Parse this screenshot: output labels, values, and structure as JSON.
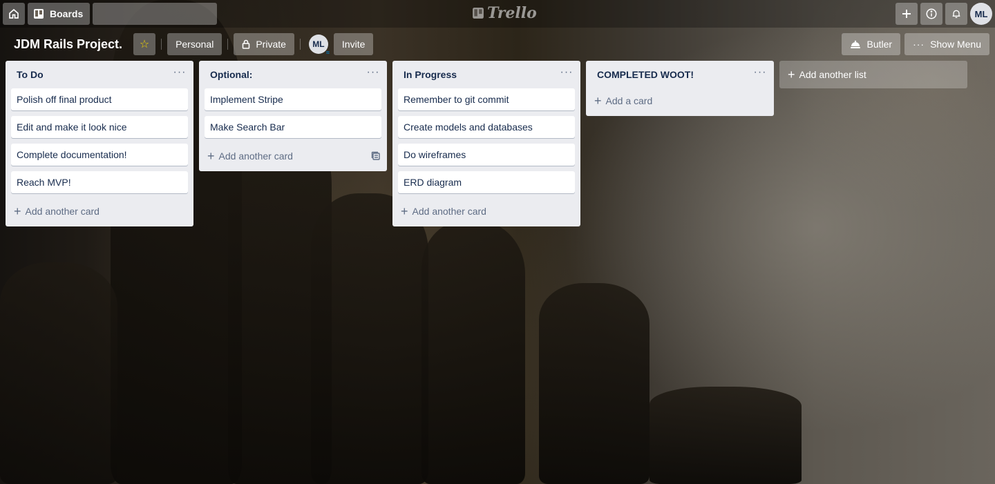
{
  "header": {
    "boards_label": "Boards",
    "search_placeholder": "",
    "logo_text": "Trello",
    "user_initials": "ML"
  },
  "board": {
    "title": "JDM Rails Project.",
    "team_label": "Personal",
    "visibility_label": "Private",
    "member_initials": "ML",
    "invite_label": "Invite",
    "butler_label": "Butler",
    "show_menu_label": "Show Menu"
  },
  "lists": [
    {
      "title": "To Do",
      "cards": [
        "Polish off final product",
        "Edit and make it look nice",
        "Complete documentation!",
        "Reach MVP!"
      ],
      "add_label": "Add another card"
    },
    {
      "title": "Optional:",
      "cards": [
        "Implement Stripe",
        "Make Search Bar"
      ],
      "add_label": "Add another card"
    },
    {
      "title": "In Progress",
      "cards": [
        "Remember to git commit",
        "Create models and databases",
        "Do wireframes",
        "ERD diagram"
      ],
      "add_label": "Add another card"
    },
    {
      "title": "COMPLETED WOOT!",
      "cards": [],
      "add_label": "Add a card"
    }
  ],
  "add_list_label": "Add another list",
  "colors": {
    "list_bg": "#ebecf0",
    "card_bg": "#ffffff",
    "text": "#172b4d",
    "muted": "#5e6c84",
    "star": "#f2d600"
  }
}
